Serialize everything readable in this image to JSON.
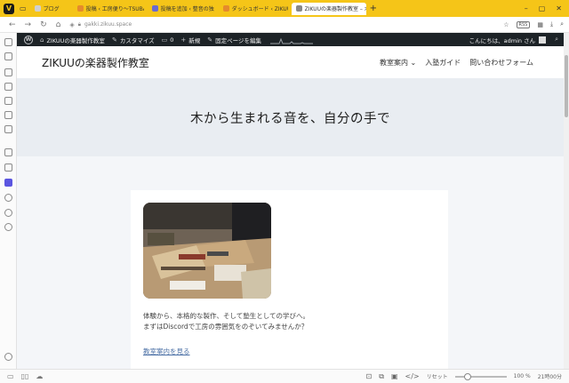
{
  "browser": {
    "logo": "V",
    "tabs": [
      {
        "label": "ブログ"
      },
      {
        "label": "投稿 ‹ 工房便り〜TSUBA..."
      },
      {
        "label": "投稿を追加 ‹ 整音の独り..."
      },
      {
        "label": "ダッシュボード ‹ ZIKUU ..."
      },
      {
        "label": "ZIKUUの楽器製作教室 – 木",
        "active": true
      }
    ],
    "url": "gakki.zikuu.space",
    "rss_label": "RSS"
  },
  "adminbar": {
    "site_name": "ZIKUUの楽器製作教室",
    "customize": "カスタマイズ",
    "comments": "0",
    "new": "新規",
    "edit": "固定ページを編集",
    "greeting": "こんにちは、admin さん"
  },
  "site": {
    "title": "ZIKUUの楽器製作教室",
    "menu": [
      "教室案内 ⌄",
      "入塾ガイド",
      "問い合わせフォーム"
    ],
    "hero_title": "木から生まれる音を、自分の手で",
    "card_line1": "体験から、本格的な製作、そして塾生としての学びへ。",
    "card_line2": "まずはDiscordで工房の雰囲気をのぞいてみませんか？",
    "card_link": "教室案内を見る"
  },
  "statusbar": {
    "reset": "リセット",
    "zoom_percent": 100,
    "zoom": "100 %",
    "time": "21時00分"
  }
}
